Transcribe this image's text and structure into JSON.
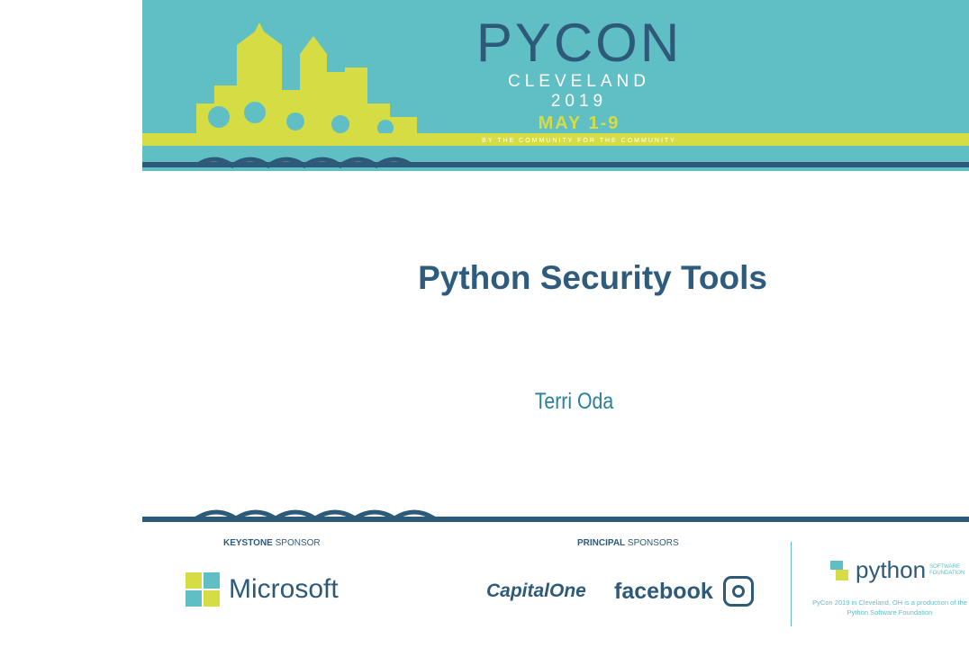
{
  "header": {
    "brand": "PYCON",
    "city": "CLEVELAND 2019",
    "dates": "MAY 1-9",
    "tagline": "BY THE COMMUNITY FOR THE COMMUNITY"
  },
  "slide": {
    "title": "Python Security Tools",
    "author": "Terri Oda"
  },
  "footer": {
    "keystone_label_bold": "KEYSTONE",
    "keystone_label": " SPONSOR",
    "principal_label_bold": "PRINCIPAL",
    "principal_label": " SPONSORS",
    "sponsors": {
      "microsoft": "Microsoft",
      "capitalone": "CapitalOne",
      "facebook": "facebook"
    },
    "psf": {
      "word": "python",
      "sub1": "SOFTWARE",
      "sub2": "FOUNDATION"
    },
    "note": "PyCon 2019 in Cleveland, OH is a production of the Python Software Foundation"
  },
  "colors": {
    "teal": "#5fbfc4",
    "navy": "#2e5a7a",
    "yellow": "#d6dc44"
  }
}
